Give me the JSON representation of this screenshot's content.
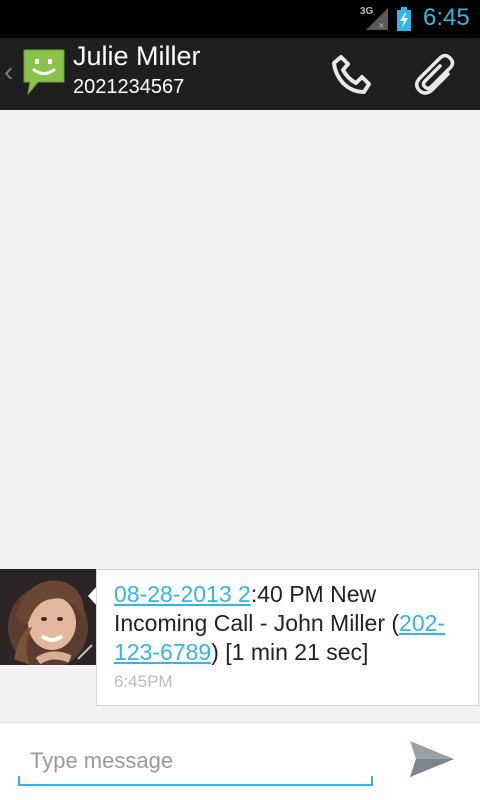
{
  "status_bar": {
    "network": "3G",
    "time": "6:45"
  },
  "action_bar": {
    "contact_name": "Julie Miller",
    "contact_number": "2021234567"
  },
  "messages": [
    {
      "link_date": "08-28-2013 2",
      "text_after_date": ":40 PM New Incoming Call - John Miller (",
      "link_phone": "202-123-6789",
      "text_after_phone": ") [1 min 21 sec]",
      "time": "6:45PM"
    }
  ],
  "composer": {
    "placeholder": "Type message"
  },
  "colors": {
    "accent": "#33b5e5",
    "action_bar": "#1f1f1f",
    "app_icon": "#8bc34a"
  }
}
